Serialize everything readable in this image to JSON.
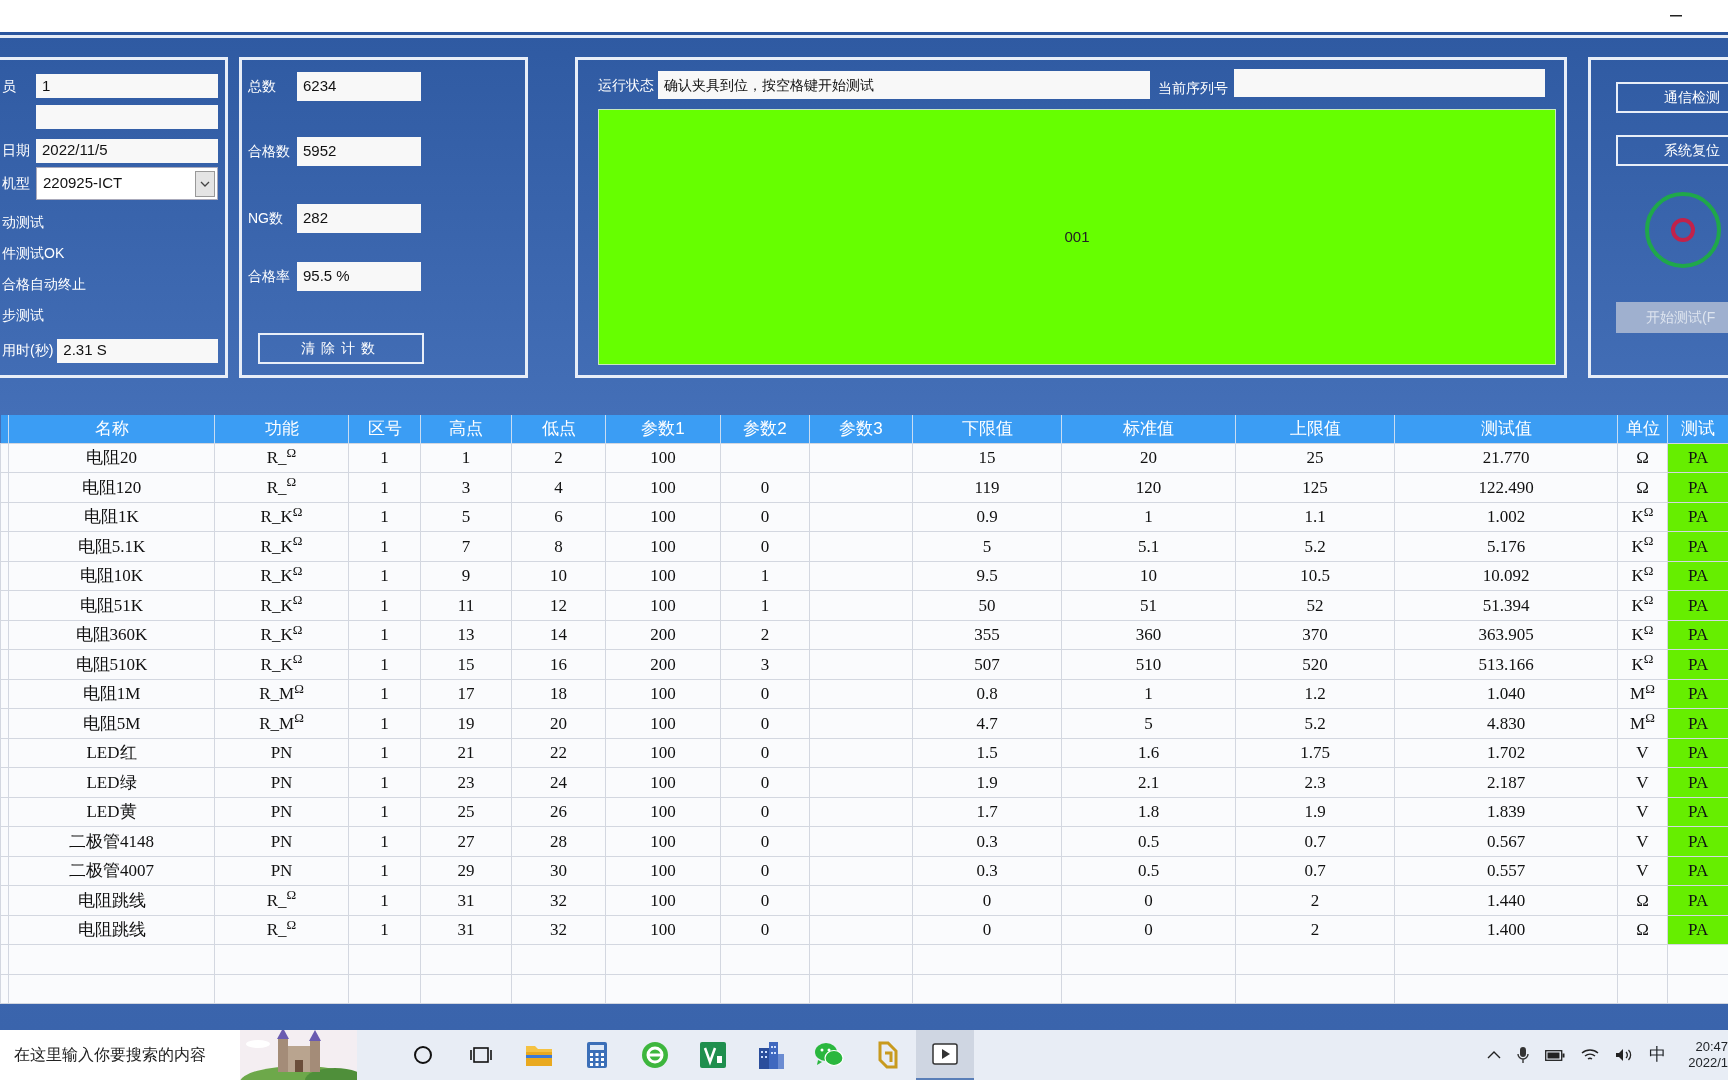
{
  "operator_panel": {
    "fields": [
      {
        "kind": "input",
        "label": "员",
        "value": "1"
      },
      {
        "kind": "input"
      },
      {
        "kind": "input",
        "label": "日期",
        "value": "2022/11/5"
      },
      {
        "kind": "select",
        "label": "机型",
        "value": "220925-ICT"
      }
    ],
    "options": [
      "动测试",
      "件测试OK",
      "合格自动终止",
      "步测试"
    ],
    "elapsed": {
      "label": "用时(秒)",
      "value": "2.31 S"
    }
  },
  "counts_panel": {
    "fields": [
      {
        "label": "总数",
        "value": "6234"
      },
      {
        "label": "合格数",
        "value": "5952"
      },
      {
        "label": "NG数",
        "value": "282"
      },
      {
        "label": "合格率",
        "value": "95.5 %"
      }
    ],
    "button": "清除计数"
  },
  "status_panel": {
    "run_status_label": "运行状态",
    "run_status": "确认夹具到位，按空格键开始测试",
    "serial_label": "当前序列号",
    "display": "001"
  },
  "control_panel": {
    "buttons": [
      {
        "label": "通信检测",
        "disabled": false
      },
      {
        "label": "系统复位",
        "disabled": false
      },
      {
        "label": "开始测试(F",
        "disabled": true
      }
    ]
  },
  "table": {
    "columns": [
      "名称",
      "功能",
      "区号",
      "高点",
      "低点",
      "参数1",
      "参数2",
      "参数3",
      "下限值",
      "标准值",
      "上限值",
      "测试值",
      "单位",
      "测试"
    ],
    "rows": [
      {
        "cells": [
          "电阻20",
          "R_$^{Ω}$",
          "1",
          "1",
          "2",
          "100",
          "",
          "",
          "15",
          "20",
          "25",
          "21.770",
          "Ω"
        ],
        "result": {
          "text": "PA",
          "pass": true
        }
      },
      {
        "cells": [
          "电阻120",
          "R_$^{Ω}$",
          "1",
          "3",
          "4",
          "100",
          "0",
          "",
          "119",
          "120",
          "125",
          "122.490",
          "Ω"
        ],
        "result": {
          "text": "PA",
          "pass": true
        }
      },
      {
        "cells": [
          "电阻1K",
          "R_K$^{Ω}$",
          "1",
          "5",
          "6",
          "100",
          "0",
          "",
          "0.9",
          "1",
          "1.1",
          "1.002",
          "K$^{Ω}$"
        ],
        "result": {
          "text": "PA",
          "pass": true
        }
      },
      {
        "cells": [
          "电阻5.1K",
          "R_K$^{Ω}$",
          "1",
          "7",
          "8",
          "100",
          "0",
          "",
          "5",
          "5.1",
          "5.2",
          "5.176",
          "K$^{Ω}$"
        ],
        "result": {
          "text": "PA",
          "pass": true
        }
      },
      {
        "cells": [
          "电阻10K",
          "R_K$^{Ω}$",
          "1",
          "9",
          "10",
          "100",
          "1",
          "",
          "9.5",
          "10",
          "10.5",
          "10.092",
          "K$^{Ω}$"
        ],
        "result": {
          "text": "PA",
          "pass": true
        }
      },
      {
        "cells": [
          "电阻51K",
          "R_K$^{Ω}$",
          "1",
          "11",
          "12",
          "100",
          "1",
          "",
          "50",
          "51",
          "52",
          "51.394",
          "K$^{Ω}$"
        ],
        "result": {
          "text": "PA",
          "pass": true
        }
      },
      {
        "cells": [
          "电阻360K",
          "R_K$^{Ω}$",
          "1",
          "13",
          "14",
          "200",
          "2",
          "",
          "355",
          "360",
          "370",
          "363.905",
          "K$^{Ω}$"
        ],
        "result": {
          "text": "PA",
          "pass": true
        }
      },
      {
        "cells": [
          "电阻510K",
          "R_K$^{Ω}$",
          "1",
          "15",
          "16",
          "200",
          "3",
          "",
          "507",
          "510",
          "520",
          "513.166",
          "K$^{Ω}$"
        ],
        "result": {
          "text": "PA",
          "pass": true
        }
      },
      {
        "cells": [
          "电阻1M",
          "R_M$^{Ω}$",
          "1",
          "17",
          "18",
          "100",
          "0",
          "",
          "0.8",
          "1",
          "1.2",
          "1.040",
          "M$^{Ω}$"
        ],
        "result": {
          "text": "PA",
          "pass": true
        }
      },
      {
        "cells": [
          "电阻5M",
          "R_M$^{Ω}$",
          "1",
          "19",
          "20",
          "100",
          "0",
          "",
          "4.7",
          "5",
          "5.2",
          "4.830",
          "M$^{Ω}$"
        ],
        "result": {
          "text": "PA",
          "pass": true
        }
      },
      {
        "cells": [
          "LED红",
          "PN",
          "1",
          "21",
          "22",
          "100",
          "0",
          "",
          "1.5",
          "1.6",
          "1.75",
          "1.702",
          "V"
        ],
        "result": {
          "text": "PA",
          "pass": true
        }
      },
      {
        "cells": [
          "LED绿",
          "PN",
          "1",
          "23",
          "24",
          "100",
          "0",
          "",
          "1.9",
          "2.1",
          "2.3",
          "2.187",
          "V"
        ],
        "result": {
          "text": "PA",
          "pass": true
        }
      },
      {
        "cells": [
          "LED黄",
          "PN",
          "1",
          "25",
          "26",
          "100",
          "0",
          "",
          "1.7",
          "1.8",
          "1.9",
          "1.839",
          "V"
        ],
        "result": {
          "text": "PA",
          "pass": true
        }
      },
      {
        "cells": [
          "二极管4148",
          "PN",
          "1",
          "27",
          "28",
          "100",
          "0",
          "",
          "0.3",
          "0.5",
          "0.7",
          "0.567",
          "V"
        ],
        "result": {
          "text": "PA",
          "pass": true
        }
      },
      {
        "cells": [
          "二极管4007",
          "PN",
          "1",
          "29",
          "30",
          "100",
          "0",
          "",
          "0.3",
          "0.5",
          "0.7",
          "0.557",
          "V"
        ],
        "result": {
          "text": "PA",
          "pass": true
        }
      },
      {
        "cells": [
          "电阻跳线",
          "R_$^{Ω}$",
          "1",
          "31",
          "32",
          "100",
          "0",
          "",
          "0",
          "0",
          "2",
          "1.440",
          "Ω"
        ],
        "result": {
          "text": "PA",
          "pass": true
        }
      },
      {
        "cells": [
          "电阻跳线",
          "R_$^{Ω}$",
          "1",
          "31",
          "32",
          "100",
          "0",
          "",
          "0",
          "0",
          "2",
          "1.400",
          "Ω"
        ],
        "result": {
          "text": "PA",
          "pass": true
        }
      }
    ]
  },
  "taskbar": {
    "search_placeholder": "在这里输入你要搜索的内容",
    "apps": [
      {
        "kind": "folder",
        "selected": false
      },
      {
        "kind": "calculator",
        "selected": false
      },
      {
        "kind": "browser",
        "selected": false
      },
      {
        "kind": "green-tile",
        "selected": false
      },
      {
        "kind": "building",
        "selected": false
      },
      {
        "kind": "chat",
        "selected": false
      },
      {
        "kind": "d-logo",
        "selected": false
      },
      {
        "kind": "player",
        "selected": true
      }
    ],
    "ime": "中",
    "time": "20:47",
    "date": "2022/1"
  }
}
